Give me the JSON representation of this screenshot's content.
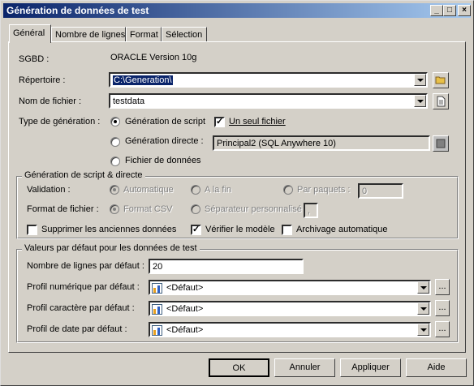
{
  "window": {
    "title": "Génération de données de test",
    "min_label": "_",
    "max_label": "□",
    "close_label": "×"
  },
  "tabs": [
    {
      "label": "Général",
      "active": true
    },
    {
      "label": "Nombre de lignes",
      "active": false
    },
    {
      "label": "Format",
      "active": false
    },
    {
      "label": "Sélection",
      "active": false
    }
  ],
  "general": {
    "sgbd_label": "SGBD :",
    "sgbd_value": "ORACLE Version 10g",
    "directory_label": "Répertoire :",
    "directory_value": "C:\\Generation\\",
    "filename_label": "Nom de fichier :",
    "filename_value": "testdata",
    "gen_type_label": "Type de génération :",
    "gen_script": "Génération de script",
    "gen_direct": "Génération directe :",
    "gen_datafile": "Fichier de données",
    "single_file": "Un seul fichier",
    "single_file_checked": true,
    "direct_source": "Principal2 (SQL Anywhere 10)"
  },
  "script_group": {
    "title": "Génération de script & directe",
    "validation_label": "Validation :",
    "opt_auto": "Automatique",
    "opt_end": "A la fin",
    "opt_batch": "Par paquets :",
    "batch_value": "0",
    "format_label": "Format de fichier :",
    "opt_csv": "Format CSV",
    "opt_custom_sep": "Séparateur personnalisé :",
    "sep_value": ",",
    "delete_old": "Supprimer les anciennes données",
    "delete_old_checked": false,
    "check_model": "Vérifier le modèle",
    "check_model_checked": true,
    "auto_archive": "Archivage automatique",
    "auto_archive_checked": false
  },
  "defaults_group": {
    "title": "Valeurs par défaut pour les données de test",
    "rows_label": "Nombre de lignes par défaut :",
    "rows_value": "20",
    "numeric_label": "Profil numérique par défaut :",
    "numeric_value": "<Défaut>",
    "char_label": "Profil caractère par défaut :",
    "char_value": "<Défaut>",
    "date_label": "Profil de date par défaut :",
    "date_value": "<Défaut>",
    "browse_label": "..."
  },
  "buttons": {
    "ok": "OK",
    "cancel": "Annuler",
    "apply": "Appliquer",
    "help": "Aide"
  }
}
